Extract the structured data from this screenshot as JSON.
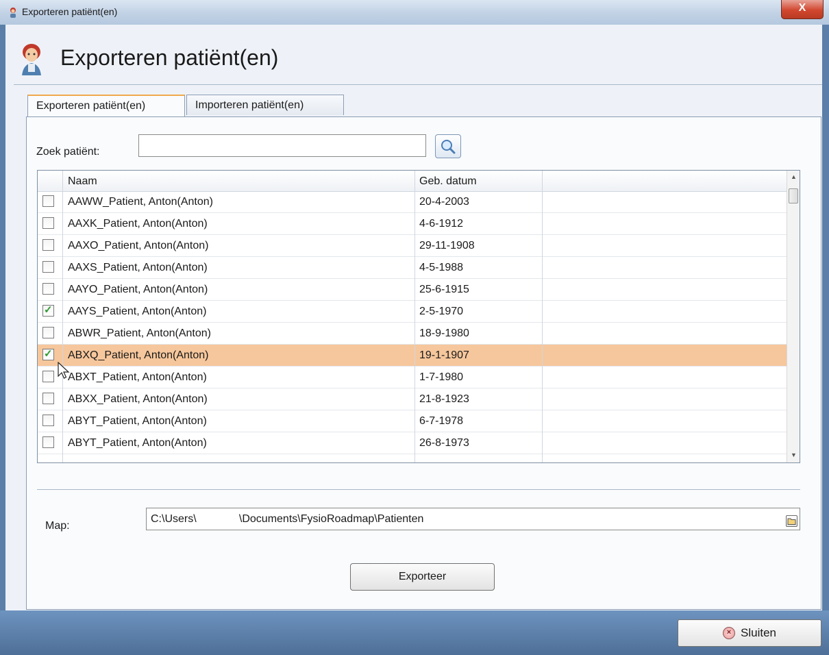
{
  "window": {
    "title": "Exporteren patiënt(en)",
    "close_glyph": "X"
  },
  "header": {
    "title": "Exporteren patiënt(en)",
    "icon": "person-avatar-icon"
  },
  "tabs": [
    {
      "label": "Exporteren patiënt(en)",
      "active": true
    },
    {
      "label": "Importeren patiënt(en)",
      "active": false
    }
  ],
  "search": {
    "label": "Zoek patiënt:",
    "value": "",
    "button_icon": "magnifier-icon"
  },
  "table": {
    "columns": [
      "Naam",
      "Geb. datum"
    ],
    "rows": [
      {
        "name": "AAWW_Patient, Anton(Anton)",
        "date": "20-4-2003",
        "checked": false,
        "selected": false
      },
      {
        "name": "AAXK_Patient, Anton(Anton)",
        "date": "4-6-1912",
        "checked": false,
        "selected": false
      },
      {
        "name": "AAXO_Patient, Anton(Anton)",
        "date": "29-11-1908",
        "checked": false,
        "selected": false
      },
      {
        "name": "AAXS_Patient, Anton(Anton)",
        "date": "4-5-1988",
        "checked": false,
        "selected": false
      },
      {
        "name": "AAYO_Patient, Anton(Anton)",
        "date": "25-6-1915",
        "checked": false,
        "selected": false
      },
      {
        "name": "AAYS_Patient, Anton(Anton)",
        "date": "2-5-1970",
        "checked": true,
        "selected": false
      },
      {
        "name": "ABWR_Patient, Anton(Anton)",
        "date": "18-9-1980",
        "checked": false,
        "selected": false
      },
      {
        "name": "ABXQ_Patient, Anton(Anton)",
        "date": "19-1-1907",
        "checked": true,
        "selected": true
      },
      {
        "name": "ABXT_Patient, Anton(Anton)",
        "date": "1-7-1980",
        "checked": false,
        "selected": false
      },
      {
        "name": "ABXX_Patient, Anton(Anton)",
        "date": "21-8-1923",
        "checked": false,
        "selected": false
      },
      {
        "name": "ABYT_Patient, Anton(Anton)",
        "date": "6-7-1978",
        "checked": false,
        "selected": false
      },
      {
        "name": "ABYT_Patient, Anton(Anton)",
        "date": "26-8-1973",
        "checked": false,
        "selected": false
      }
    ]
  },
  "map": {
    "label": "Map:",
    "value": "C:\\Users\\              \\Documents\\FysioRoadmap\\Patienten",
    "button_icon": "folder-icon"
  },
  "export_button": {
    "label": "Exporteer"
  },
  "close_button": {
    "label": "Sluiten",
    "icon": "close-circle-icon"
  },
  "colors": {
    "selected_row": "#f6c79c",
    "active_tab_accent": "#f0a94a",
    "check_green": "#2f9a2f"
  }
}
